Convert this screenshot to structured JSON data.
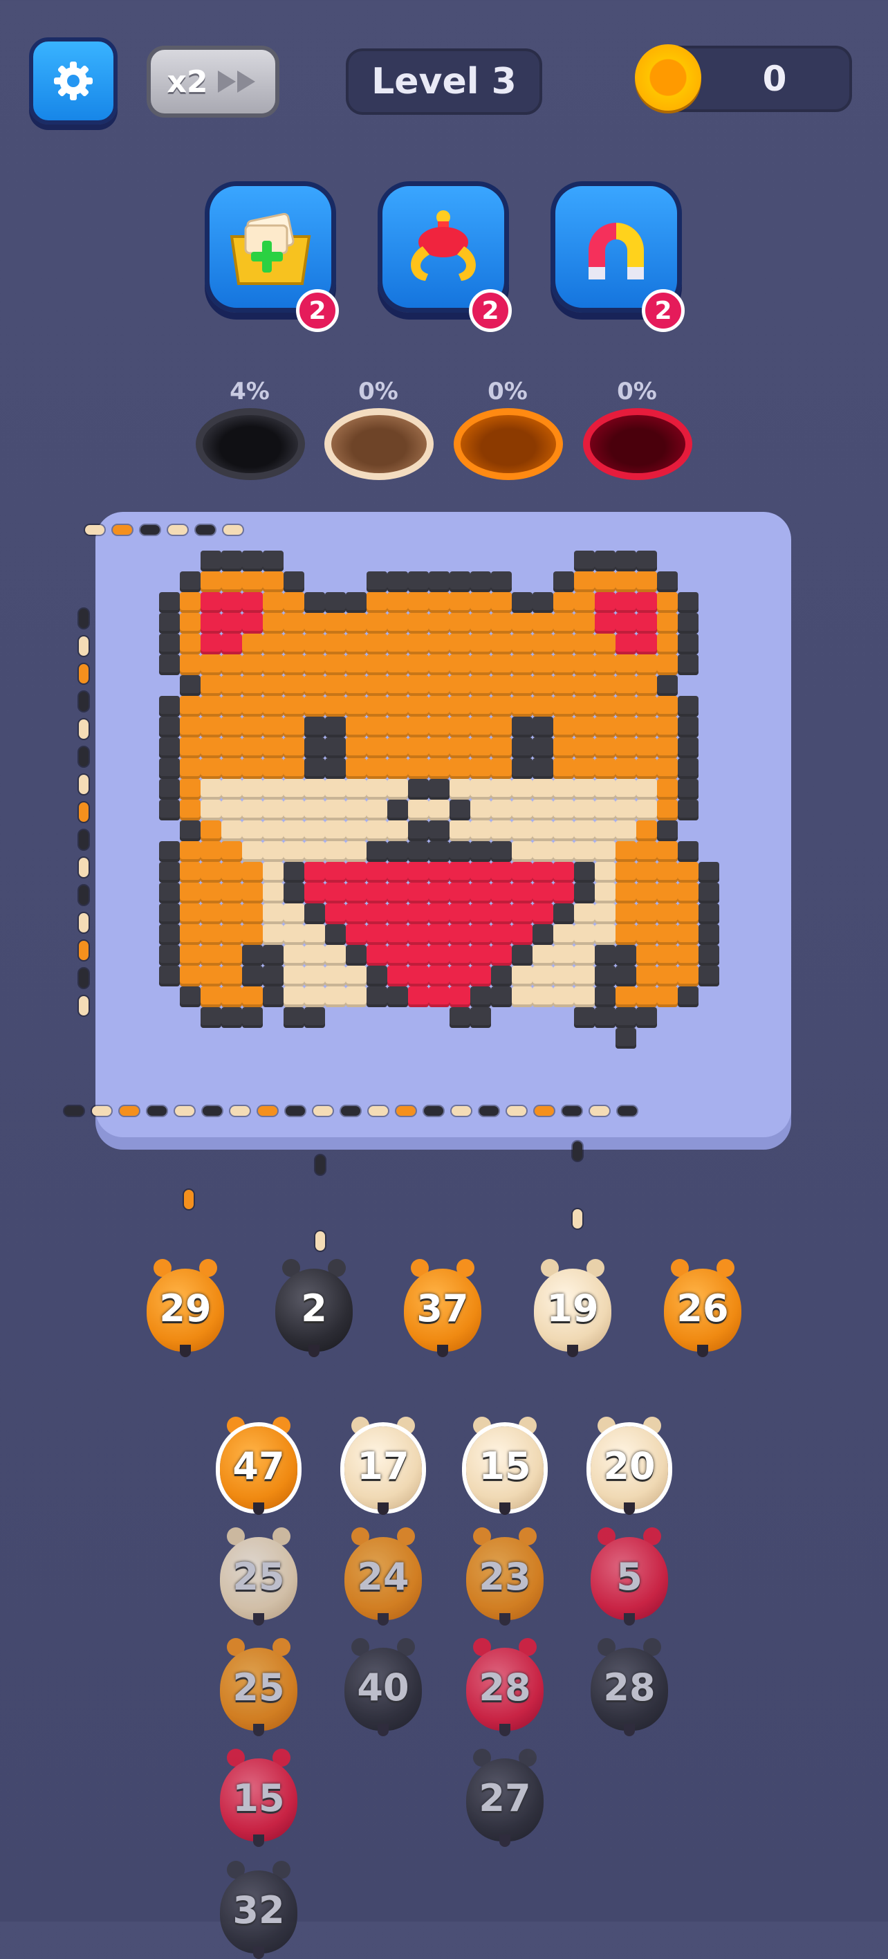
{
  "header": {
    "speed_label": "x2",
    "level_label": "Level 3",
    "coins": "0"
  },
  "boosters": [
    {
      "name": "add-slot",
      "count": "2"
    },
    {
      "name": "claw",
      "count": "2"
    },
    {
      "name": "magnet",
      "count": "2"
    }
  ],
  "holes": [
    {
      "percent": "4%",
      "color": "#1d1d22",
      "rim": "#3a3a44"
    },
    {
      "percent": "0%",
      "color": "#8a5a3a",
      "rim": "#f3dcc0"
    },
    {
      "percent": "0%",
      "color": "#b84d00",
      "rim": "#ff8a12"
    },
    {
      "percent": "0%",
      "color": "#6a0010",
      "rim": "#e61c3c"
    }
  ],
  "palette": {
    "orange": "#f5901d",
    "dark": "#3c3c44",
    "cream": "#f4dcb6",
    "red": "#ec2449",
    "board": "#a7b0ee"
  },
  "waiting_bugs": [
    {
      "value": "29",
      "kind": "orange"
    },
    {
      "value": "2",
      "kind": "black"
    },
    {
      "value": "37",
      "kind": "orange"
    },
    {
      "value": "19",
      "kind": "cream"
    },
    {
      "value": "26",
      "kind": "orange"
    }
  ],
  "queue": [
    [
      {
        "value": "47",
        "kind": "orange",
        "active": true
      },
      {
        "value": "25",
        "kind": "cream"
      },
      {
        "value": "25",
        "kind": "orange"
      },
      {
        "value": "15",
        "kind": "red"
      },
      {
        "value": "32",
        "kind": "black"
      }
    ],
    [
      {
        "value": "17",
        "kind": "cream",
        "active": true
      },
      {
        "value": "24",
        "kind": "orange"
      },
      {
        "value": "40",
        "kind": "black"
      }
    ],
    [
      {
        "value": "15",
        "kind": "cream",
        "active": true
      },
      {
        "value": "23",
        "kind": "orange"
      },
      {
        "value": "28",
        "kind": "red"
      },
      {
        "value": "27",
        "kind": "black"
      }
    ],
    [
      {
        "value": "20",
        "kind": "cream",
        "active": true
      },
      {
        "value": "5",
        "kind": "red"
      },
      {
        "value": "28",
        "kind": "black"
      }
    ]
  ]
}
